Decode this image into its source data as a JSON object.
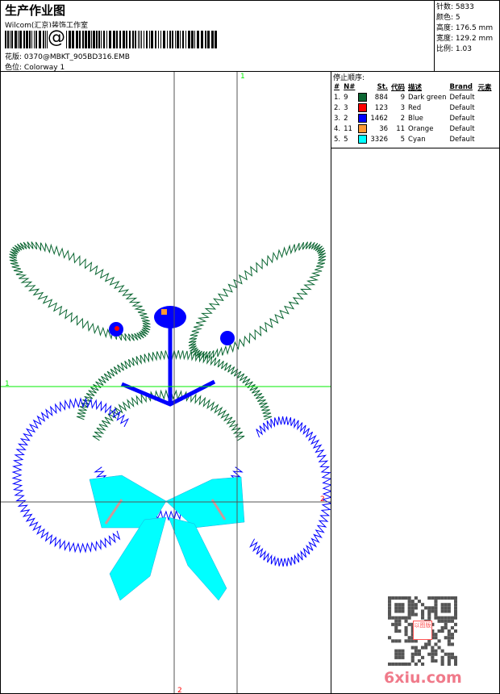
{
  "header": {
    "title": "生产作业图",
    "company": "Wilcom(汇京)装饰工作室",
    "barcode_text": "@",
    "design_file_label": "花版:",
    "design_file": "0370@MBKT_905BD316.EMB",
    "colorway_label": "色位:",
    "colorway": "Colorway 1"
  },
  "stats": [
    {
      "label": "针数:",
      "value": "5833"
    },
    {
      "label": "颜色:",
      "value": "5"
    },
    {
      "label": "高度:",
      "value": "176.5 mm"
    },
    {
      "label": "宽度:",
      "value": "129.2 mm"
    },
    {
      "label": "比例:",
      "value": "1.03"
    }
  ],
  "stop_sequence": {
    "title": "停止顺序:",
    "headers": [
      "#",
      "N#",
      "St.",
      "代码",
      "描述",
      "Brand",
      "元素"
    ],
    "rows": [
      {
        "idx": "1.",
        "n": "9",
        "color": "#0b6632",
        "st": "884",
        "code": "9",
        "desc": "Dark green",
        "brand": "Default"
      },
      {
        "idx": "2.",
        "n": "3",
        "color": "#ff0000",
        "st": "123",
        "code": "3",
        "desc": "Red",
        "brand": "Default"
      },
      {
        "idx": "3.",
        "n": "2",
        "color": "#0000ff",
        "st": "1462",
        "code": "2",
        "desc": "Blue",
        "brand": "Default"
      },
      {
        "idx": "4.",
        "n": "11",
        "color": "#ff9933",
        "st": "36",
        "code": "11",
        "desc": "Orange",
        "brand": "Default"
      },
      {
        "idx": "5.",
        "n": "5",
        "color": "#00ffff",
        "st": "3326",
        "code": "5",
        "desc": "Cyan",
        "brand": "Default"
      }
    ]
  },
  "guides": {
    "green_label": "1",
    "black_label": "2",
    "green": "#00ee00",
    "label_red": "#ff0000"
  },
  "watermark": {
    "site": "6xiu.com",
    "stamp": "以图版"
  }
}
